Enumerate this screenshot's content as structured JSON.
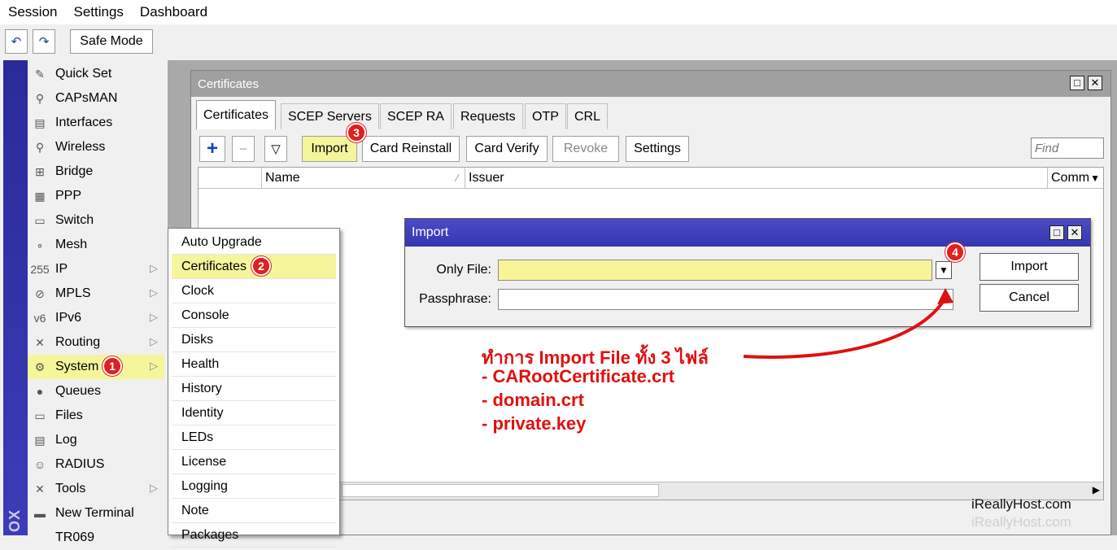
{
  "menubar": [
    "Session",
    "Settings",
    "Dashboard"
  ],
  "toolbar": {
    "undo_icon": "undo-icon",
    "redo_icon": "redo-icon",
    "safe_mode": "Safe Mode"
  },
  "vstrip_text": "OX",
  "sidebar": {
    "items": [
      {
        "label": "Quick Set",
        "icon": "quick-set-icon",
        "glyph": "✎"
      },
      {
        "label": "CAPsMAN",
        "icon": "capsman-icon",
        "glyph": "⚲"
      },
      {
        "label": "Interfaces",
        "icon": "interfaces-icon",
        "glyph": "▤"
      },
      {
        "label": "Wireless",
        "icon": "wireless-icon",
        "glyph": "⚲"
      },
      {
        "label": "Bridge",
        "icon": "bridge-icon",
        "glyph": "⊞"
      },
      {
        "label": "PPP",
        "icon": "ppp-icon",
        "glyph": "▦"
      },
      {
        "label": "Switch",
        "icon": "switch-icon",
        "glyph": "▭"
      },
      {
        "label": "Mesh",
        "icon": "mesh-icon",
        "glyph": "∘"
      },
      {
        "label": "IP",
        "icon": "ip-icon",
        "glyph": "255",
        "arrow": true
      },
      {
        "label": "MPLS",
        "icon": "mpls-icon",
        "glyph": "⊘",
        "arrow": true
      },
      {
        "label": "IPv6",
        "icon": "ipv6-icon",
        "glyph": "v6",
        "arrow": true
      },
      {
        "label": "Routing",
        "icon": "routing-icon",
        "glyph": "✕",
        "arrow": true
      },
      {
        "label": "System",
        "icon": "system-icon",
        "glyph": "⚙",
        "arrow": true
      },
      {
        "label": "Queues",
        "icon": "queues-icon",
        "glyph": "●"
      },
      {
        "label": "Files",
        "icon": "files-icon",
        "glyph": "▭"
      },
      {
        "label": "Log",
        "icon": "log-icon",
        "glyph": "▤"
      },
      {
        "label": "RADIUS",
        "icon": "radius-icon",
        "glyph": "☺"
      },
      {
        "label": "Tools",
        "icon": "tools-icon",
        "glyph": "✕",
        "arrow": true
      },
      {
        "label": "New Terminal",
        "icon": "terminal-icon",
        "glyph": "▬"
      },
      {
        "label": "TR069",
        "icon": "tr069-icon",
        "glyph": ""
      }
    ],
    "selected": "System"
  },
  "submenu": {
    "items": [
      "Auto Upgrade",
      "Certificates",
      "Clock",
      "Console",
      "Disks",
      "Health",
      "History",
      "Identity",
      "LEDs",
      "License",
      "Logging",
      "Note",
      "Packages"
    ],
    "selected": "Certificates"
  },
  "certwin": {
    "title": "Certificates",
    "tabs": [
      "Certificates",
      "SCEP Servers",
      "SCEP RA",
      "Requests",
      "OTP",
      "CRL"
    ],
    "buttons": {
      "import": "Import",
      "card_reinstall": "Card Reinstall",
      "card_verify": "Card Verify",
      "revoke": "Revoke",
      "settings": "Settings"
    },
    "find_placeholder": "Find",
    "columns": {
      "name": "Name",
      "issuer": "Issuer",
      "comment": "Comm"
    }
  },
  "import_dialog": {
    "title": "Import",
    "only_file_label": "Only File:",
    "only_file_value": "",
    "passphrase_label": "Passphrase:",
    "passphrase_value": "",
    "import_button": "Import",
    "cancel_button": "Cancel"
  },
  "badges": [
    "1",
    "2",
    "3",
    "4"
  ],
  "annotation": {
    "line1": "ทำการ Import File ทั้ง 3 ไฟล์",
    "line2": "- CARootCertificate.crt",
    "line3": "- domain.crt",
    "line4": "- private.key"
  },
  "watermark": "iReallyHost.com",
  "colors": {
    "selection": "#f5f59c",
    "dialog_title": "#3c3cb8",
    "annotation": "#e01010",
    "badge": "#e02020"
  }
}
